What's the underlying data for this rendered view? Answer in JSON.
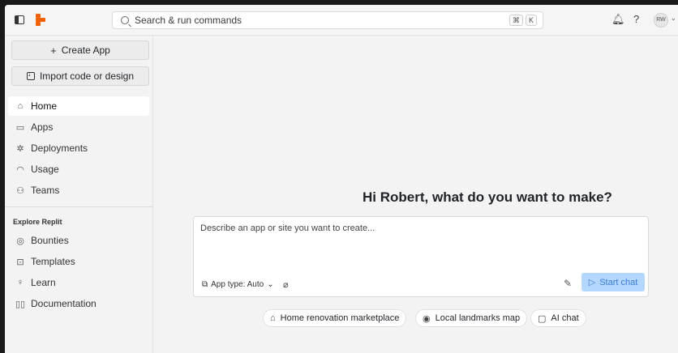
{
  "topbar": {
    "search_placeholder": "Search & run commands",
    "shortcut_keys": [
      "⌘",
      "K"
    ],
    "avatar_initials": "RW"
  },
  "sidebar": {
    "create_app_label": "Create App",
    "import_label": "Import code or design",
    "nav_items": [
      {
        "label": "Home",
        "icon": "home-icon",
        "active": true
      },
      {
        "label": "Apps",
        "icon": "folder-icon"
      },
      {
        "label": "Deployments",
        "icon": "deploy-icon"
      },
      {
        "label": "Usage",
        "icon": "gauge-icon"
      },
      {
        "label": "Teams",
        "icon": "people-icon"
      }
    ],
    "explore_title": "Explore Replit",
    "explore_items": [
      {
        "label": "Bounties",
        "icon": "target-icon"
      },
      {
        "label": "Templates",
        "icon": "template-icon"
      },
      {
        "label": "Learn",
        "icon": "lightbulb-icon"
      },
      {
        "label": "Documentation",
        "icon": "book-icon"
      }
    ]
  },
  "main": {
    "headline": "Hi Robert, what do you want to make?",
    "composer_placeholder": "Describe an app or site you want to create...",
    "app_type_label": "App type: Auto",
    "start_chat_label": "Start chat",
    "suggestions": [
      "Home renovation marketplace",
      "Local landmarks map",
      "AI chat"
    ]
  },
  "colors": {
    "brand": "#f26207",
    "start_button_bg": "#b3d7ff",
    "start_button_text": "#3d7bd6"
  }
}
